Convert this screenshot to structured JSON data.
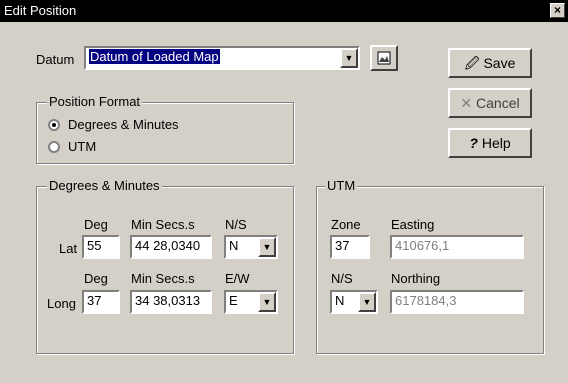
{
  "window": {
    "title": "Edit Position",
    "close_glyph": "×"
  },
  "datum": {
    "label": "Datum",
    "value": "Datum of Loaded Map"
  },
  "buttons": {
    "save": "Save",
    "cancel": "Cancel",
    "help": "Help"
  },
  "position_format": {
    "title": "Position Format",
    "options": [
      "Degrees & Minutes",
      "UTM"
    ],
    "selected": "Degrees & Minutes"
  },
  "dm": {
    "title": "Degrees & Minutes",
    "deg_label": "Deg",
    "min_label": "Min Secs.s",
    "ns_label": "N/S",
    "ew_label": "E/W",
    "lat_label": "Lat",
    "long_label": "Long",
    "lat_deg": "55",
    "lat_min": "44 28,0340",
    "lat_ns": "N",
    "long_deg": "37",
    "long_min": "34 38,0313",
    "long_ew": "E"
  },
  "utm": {
    "title": "UTM",
    "zone_label": "Zone",
    "easting_label": "Easting",
    "ns_label": "N/S",
    "northing_label": "Northing",
    "zone": "37",
    "easting": "410676,1",
    "ns": "N",
    "northing": "6178184,3"
  },
  "icons": [
    "close-icon",
    "map-icon",
    "save-icon",
    "cancel-icon",
    "help-icon",
    "chevron-down-icon"
  ]
}
